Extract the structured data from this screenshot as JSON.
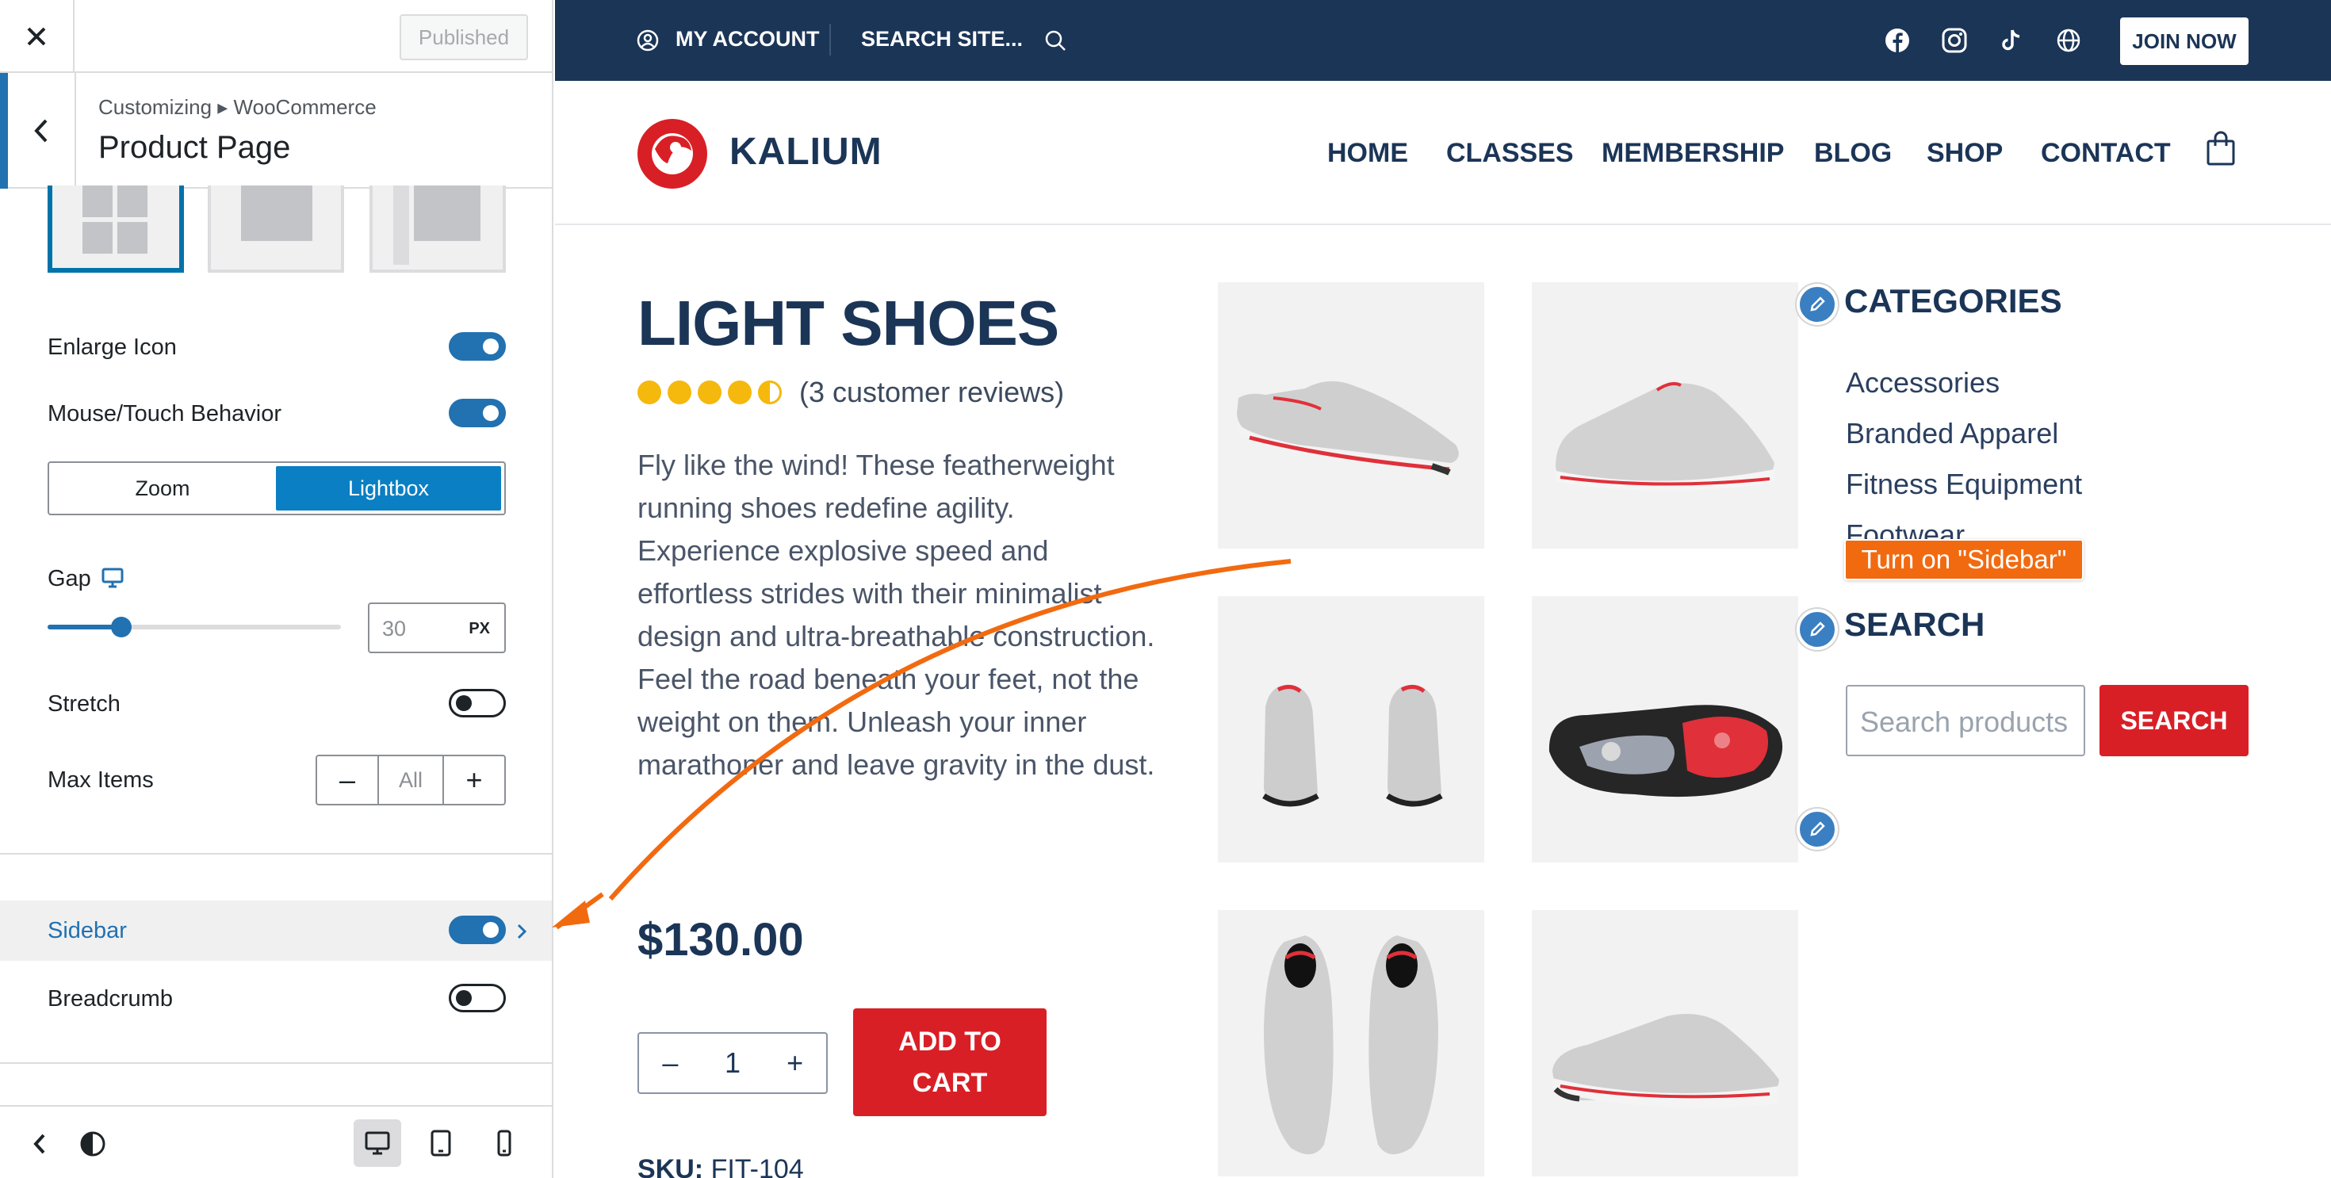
{
  "customizer": {
    "published_label": "Published",
    "breadcrumb": "Customizing ▸ WooCommerce",
    "title": "Product Page",
    "enlarge_icon": {
      "label": "Enlarge Icon",
      "on": true
    },
    "mouse_touch": {
      "label": "Mouse/Touch Behavior",
      "on": true
    },
    "behavior_options": [
      "Zoom",
      "Lightbox"
    ],
    "behavior_selected": "Lightbox",
    "gap": {
      "label": "Gap",
      "value": "30",
      "unit": "PX",
      "slider_fraction": 0.25
    },
    "stretch": {
      "label": "Stretch",
      "on": false
    },
    "max_items": {
      "label": "Max Items",
      "value": "All",
      "minus": "–",
      "plus": "+"
    },
    "sidebar": {
      "label": "Sidebar",
      "on": true
    },
    "breadcrumb_toggle": {
      "label": "Breadcrumb",
      "on": false
    }
  },
  "site": {
    "topbar": {
      "my_account": "MY ACCOUNT",
      "search_site": "SEARCH SITE...",
      "join_now": "JOIN NOW",
      "social_icons": [
        "facebook-icon",
        "instagram-icon",
        "tiktok-icon",
        "globe-icon"
      ]
    },
    "brand": "KALIUM",
    "nav": [
      "HOME",
      "CLASSES",
      "MEMBERSHIP",
      "BLOG",
      "SHOP",
      "CONTACT"
    ],
    "product": {
      "title": "LIGHT SHOES",
      "rating": 4.5,
      "reviews": "(3 customer reviews)",
      "description": "Fly like the wind! These featherweight running shoes redefine agility. Experience explosive speed and effortless strides with their minimalist design and ultra-breathable construction. Feel the road beneath your feet, not the weight on them. Unleash your inner marathoner and leave gravity in the dust.",
      "price": "$130.00",
      "quantity": "1",
      "qty_minus": "–",
      "qty_plus": "+",
      "add_to_cart": "ADD TO CART",
      "sku_label": "SKU:",
      "sku": "FIT-104"
    },
    "sidebar": {
      "categories_title": "CATEGORIES",
      "categories": [
        "Accessories",
        "Branded Apparel",
        "Fitness Equipment",
        "Footwear"
      ],
      "search_title": "SEARCH",
      "search_placeholder": "Search products",
      "search_button": "SEARCH"
    }
  },
  "annotation": {
    "text": "Turn on \"Sidebar\""
  },
  "colors": {
    "navy": "#1b3557",
    "red": "#d91f26",
    "accent_blue": "#2271b1",
    "annotation_orange": "#f26a10"
  }
}
